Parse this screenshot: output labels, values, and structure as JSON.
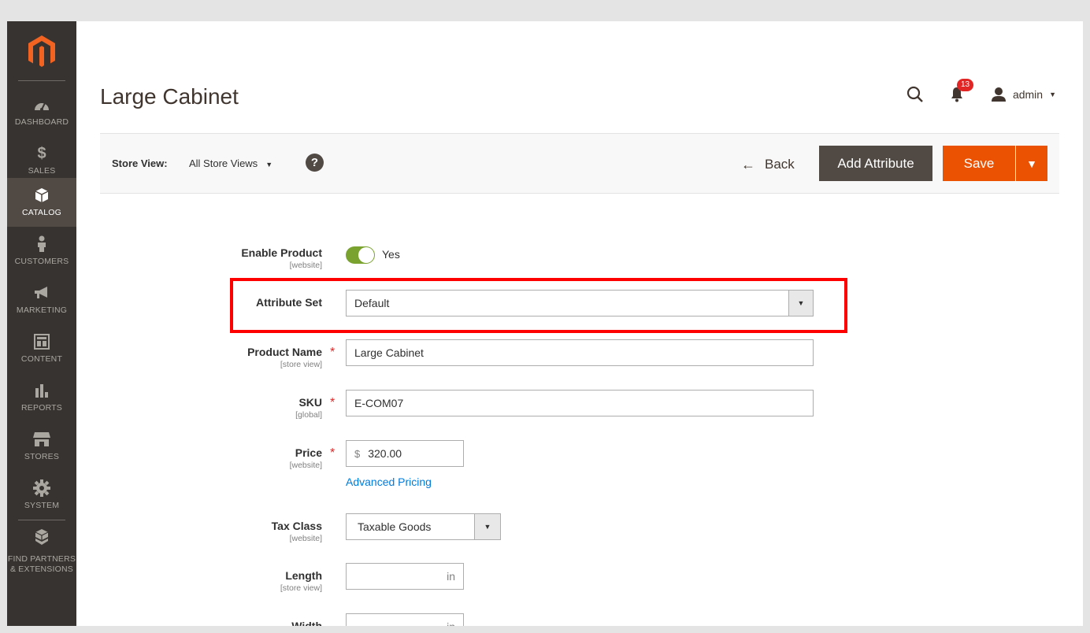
{
  "sidebar": {
    "items": [
      {
        "label": "DASHBOARD",
        "icon": "dashboard-icon"
      },
      {
        "label": "SALES",
        "icon": "dollar-icon"
      },
      {
        "label": "CATALOG",
        "icon": "box-icon",
        "active": true
      },
      {
        "label": "CUSTOMERS",
        "icon": "person-icon"
      },
      {
        "label": "MARKETING",
        "icon": "megaphone-icon"
      },
      {
        "label": "CONTENT",
        "icon": "layout-icon"
      },
      {
        "label": "REPORTS",
        "icon": "bar-chart-icon"
      },
      {
        "label": "STORES",
        "icon": "store-icon"
      },
      {
        "label": "SYSTEM",
        "icon": "gear-icon"
      },
      {
        "label": "FIND PARTNERS & EXTENSIONS",
        "icon": "cubes-icon"
      }
    ]
  },
  "header": {
    "title": "Large Cabinet",
    "notifications_count": "13",
    "user": "admin"
  },
  "toolbar": {
    "store_view_label": "Store View:",
    "store_view_value": "All Store Views",
    "help": "?",
    "back_label": "Back",
    "add_attribute_label": "Add Attribute",
    "save_label": "Save"
  },
  "form": {
    "enable_product": {
      "label": "Enable Product",
      "scope": "[website]",
      "value": "Yes"
    },
    "attribute_set": {
      "label": "Attribute Set",
      "value": "Default"
    },
    "product_name": {
      "label": "Product Name",
      "scope": "[store view]",
      "value": "Large Cabinet"
    },
    "sku": {
      "label": "SKU",
      "scope": "[global]",
      "value": "E-COM07"
    },
    "price": {
      "label": "Price",
      "scope": "[website]",
      "currency": "$",
      "value": "320.00",
      "advanced_link": "Advanced Pricing"
    },
    "tax_class": {
      "label": "Tax Class",
      "scope": "[website]",
      "value": "Taxable Goods"
    },
    "length": {
      "label": "Length",
      "scope": "[store view]",
      "unit": "in"
    },
    "width": {
      "label": "Width",
      "unit": "in"
    }
  },
  "colors": {
    "accent": "#eb5202",
    "sidebar": "#373330",
    "highlight": "#ff0000",
    "toggle_on": "#79a22e",
    "link": "#007bdb"
  }
}
